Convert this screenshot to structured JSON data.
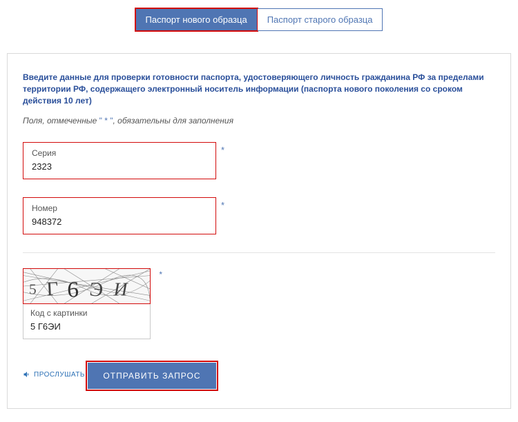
{
  "tabs": {
    "new": "Паспорт нового образца",
    "old": "Паспорт старого образца"
  },
  "intro": "Введите данные для проверки готовности паспорта, удостоверяющего личность гражданина РФ за пределами территории РФ, содержащего электронный носитель информации (паспорта нового поколения со сроком действия 10 лет)",
  "required_note_pre": "Поля, отмеченные ",
  "required_note_star": "\" * \"",
  "required_note_post": ", обязательны для заполнения",
  "fields": {
    "series": {
      "label": "Серия",
      "value": "2323"
    },
    "number": {
      "label": "Номер",
      "value": "948372"
    }
  },
  "captcha": {
    "image_text": "5 Г6ЭИ",
    "label": "Код с картинки",
    "value": "5 Г6ЭИ",
    "listen": "ПРОСЛУШАТЬ"
  },
  "submit": "ОТПРАВИТЬ ЗАПРОС"
}
